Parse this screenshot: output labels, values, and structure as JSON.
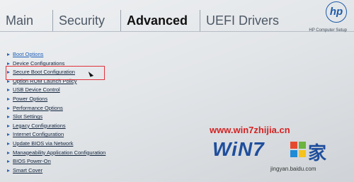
{
  "tabs": [
    {
      "label": "Main"
    },
    {
      "label": "Security"
    },
    {
      "label": "Advanced"
    },
    {
      "label": "UEFI Drivers"
    }
  ],
  "active_tab": "Advanced",
  "header": {
    "logo_text": "hp",
    "setup_label": "HP Computer Setup"
  },
  "menu": {
    "items": [
      {
        "label": "Boot Options"
      },
      {
        "label": "Device Configurations"
      },
      {
        "label": "Secure Boot Configuration"
      },
      {
        "label": "Option ROM Launch Policy"
      },
      {
        "label": "USB Device Control"
      },
      {
        "label": "Power Options"
      },
      {
        "label": "Performance Options"
      },
      {
        "label": "Slot Settings"
      },
      {
        "label": "Legacy Configurations"
      },
      {
        "label": "Internet Configuration"
      },
      {
        "label": "Update BIOS via Network"
      },
      {
        "label": "Manageability Application Configuration"
      },
      {
        "label": "BIOS Power-On"
      },
      {
        "label": "Smart Cover"
      }
    ],
    "highlighted_item": "Secure Boot Configuration"
  },
  "watermark": {
    "url": "www.win7zhijia.cn",
    "brand": "WiN7",
    "brand_suffix": "家",
    "baidu": "jingyan.baidu.com"
  },
  "colors": {
    "accent": "#2b65b3",
    "highlight_box": "#e0323a",
    "watermark_red": "#d42222",
    "watermark_blue": "#1f4e9c"
  }
}
